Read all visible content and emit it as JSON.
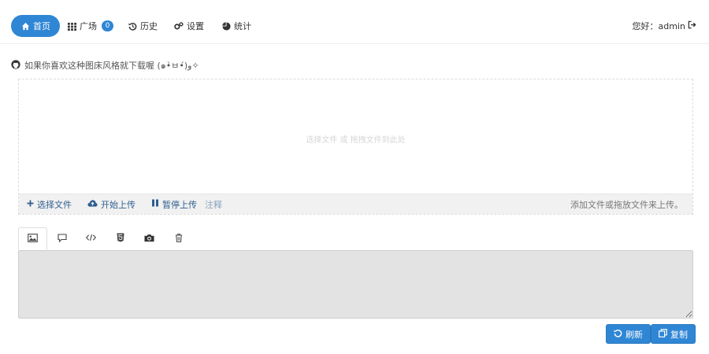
{
  "nav": {
    "home": "首页",
    "square": "广场",
    "square_count": "0",
    "history": "历史",
    "settings": "设置",
    "stats": "统计"
  },
  "user": {
    "greeting": "您好：admin"
  },
  "notice": "如果你喜欢这种图床风格就下载喔 (๑•̀ㅂ•́)و✧",
  "upload": {
    "drop_hint": "选择文件 或 拖拽文件到此处",
    "choose_files": "选择文件",
    "start_upload": "开始上传",
    "pause_upload": "暂停上传",
    "extra": "注释",
    "right_hint": "添加文件或拖放文件来上传。"
  },
  "tabs": [
    "image-icon",
    "comment-icon",
    "code-icon",
    "html5-icon",
    "camera-icon",
    "trash-icon"
  ],
  "buttons": {
    "refresh": "刷新",
    "copy": "复制"
  },
  "colors": {
    "accent": "#2f86d4",
    "toolbar_text": "#2f5f8f",
    "output_bg": "#e3e3e3"
  }
}
